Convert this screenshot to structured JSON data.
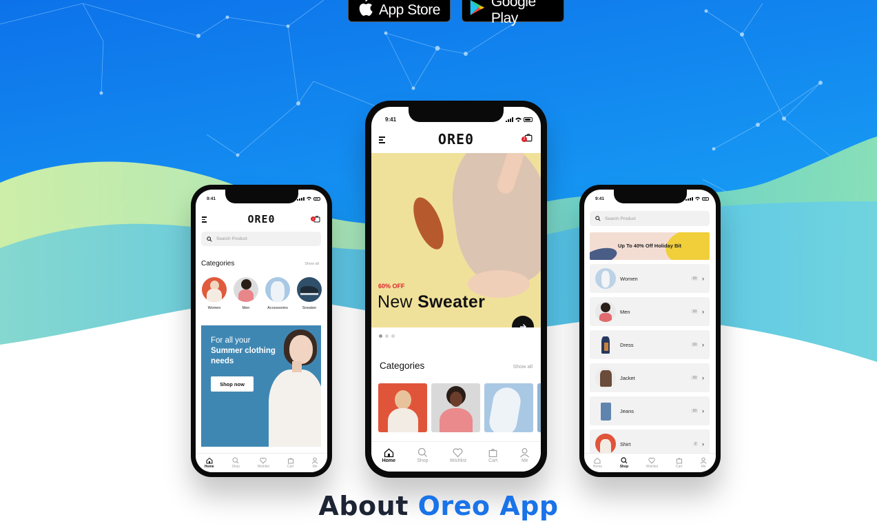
{
  "badges": {
    "app_store": "App Store",
    "google_play": "Google Play"
  },
  "phone_left": {
    "time": "9:41",
    "logo": "ORE0",
    "cart_count": "2",
    "search_placeholder": "Search Product",
    "categories_title": "Categories",
    "show_all": "Show all",
    "categories": [
      "Women",
      "Men",
      "Accessories",
      "Sneaker"
    ],
    "promo": {
      "line1": "For all your",
      "line2": "Summer clothing",
      "line3": "needs",
      "button": "Shop now"
    },
    "tabs": [
      "Home",
      "Shop",
      "Wishlist",
      "Cart",
      "Me"
    ],
    "active_tab": "Home"
  },
  "phone_center": {
    "time": "9:41",
    "logo": "ORE0",
    "cart_count": "2",
    "banner": {
      "discount": "60% OFF",
      "title_light": "New",
      "title_bold": "Sweater"
    },
    "categories_title": "Categories",
    "show_all": "Show all",
    "tabs": [
      "Home",
      "Shop",
      "Wishlist",
      "Cart",
      "Me"
    ],
    "active_tab": "Home"
  },
  "phone_right": {
    "time": "9:41",
    "search_placeholder": "Search Product",
    "offer": "Up To 40%  Off Holiday Bit",
    "categories": [
      {
        "name": "Women",
        "count": "10"
      },
      {
        "name": "Men",
        "count": "10"
      },
      {
        "name": "Dress",
        "count": "10"
      },
      {
        "name": "Jacket",
        "count": "10"
      },
      {
        "name": "Jeans",
        "count": "10"
      },
      {
        "name": "Shirt",
        "count": "2"
      }
    ],
    "tabs": [
      "Home",
      "Shop",
      "Wishlist",
      "Cart",
      "Me"
    ],
    "active_tab": "Shop"
  },
  "about": {
    "prefix": "About",
    "accent": "Oreo App"
  },
  "colors": {
    "sky_top": "#1380ee",
    "sky_mid": "#1ea3f7",
    "wave_green": "#8ee3b5",
    "wave_yellow": "#d9f2a0",
    "accent_blue": "#1a73e8",
    "badge_red": "#e0202a",
    "promo_blue": "#3f87b3",
    "banner_yellow": "#f0e19a"
  }
}
